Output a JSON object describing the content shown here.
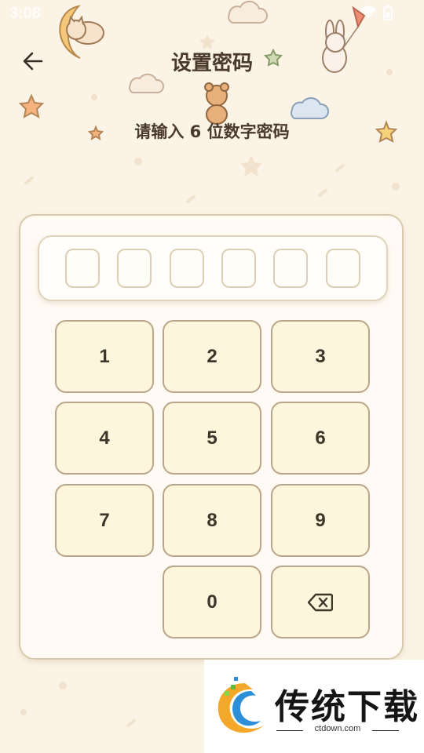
{
  "status_bar": {
    "time": "3:08",
    "icons": [
      "wifi-icon",
      "battery-icon"
    ]
  },
  "header": {
    "back_icon": "arrow-left-icon",
    "title": "设置密码"
  },
  "prompt": "请输入 6 位数字密码",
  "pin": {
    "length": 6,
    "entered": 0
  },
  "keypad": {
    "keys": [
      "1",
      "2",
      "3",
      "4",
      "5",
      "6",
      "7",
      "8",
      "9",
      "",
      "0",
      "⌫"
    ],
    "backspace_icon": "backspace-icon"
  },
  "watermark": {
    "brand": "传统下载",
    "url": "ctdown.com"
  },
  "colors": {
    "background": "#fbf4e6",
    "text": "#4a3a2c",
    "key_fill": "#fdf6dd",
    "key_border": "#b9a68a",
    "panel_fill": "#fffaf3"
  }
}
